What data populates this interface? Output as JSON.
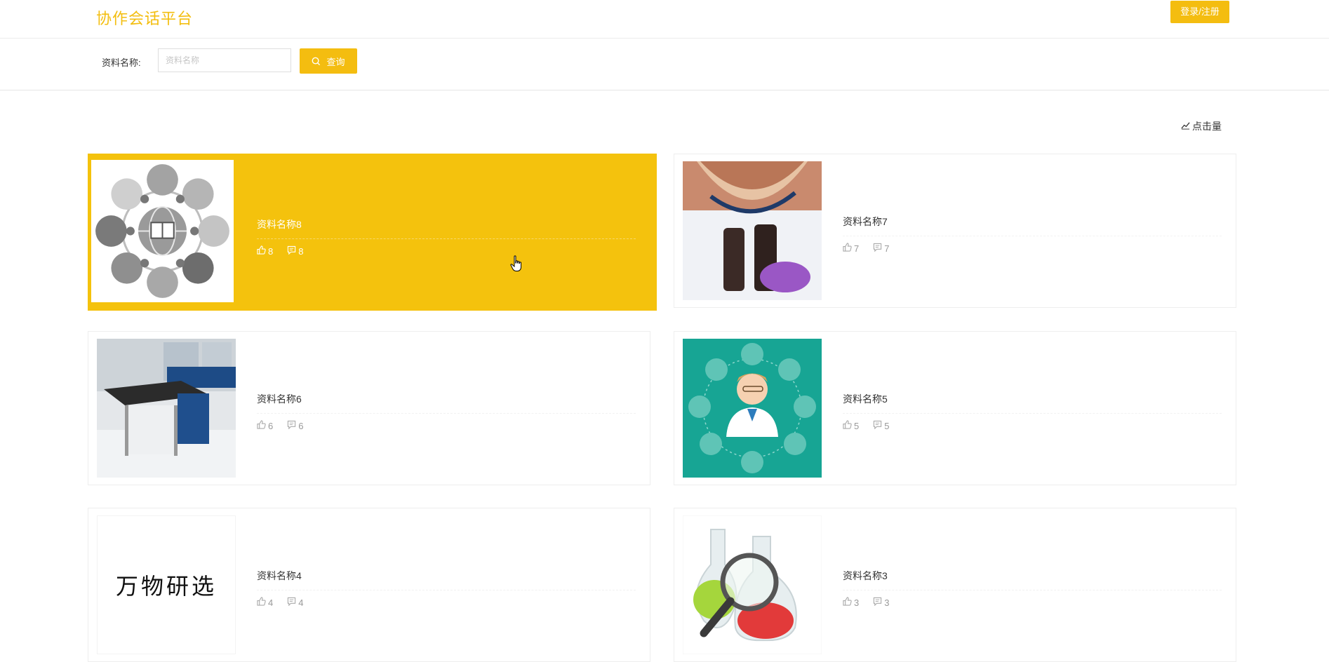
{
  "header": {
    "brand": "协作会话平台",
    "login_label": "登录/注册"
  },
  "search": {
    "label": "资料名称:",
    "placeholder": "资料名称",
    "button_label": "查询"
  },
  "sort": {
    "label": "点击量"
  },
  "colors": {
    "accent": "#f4bd10"
  },
  "cards": [
    {
      "title": "资料名称8",
      "likes": "8",
      "comments": "8",
      "image": "science-icons-circle"
    },
    {
      "title": "资料名称7",
      "likes": "7",
      "comments": "7",
      "image": "microscope-researcher"
    },
    {
      "title": "资料名称6",
      "likes": "6",
      "comments": "6",
      "image": "laboratory-room"
    },
    {
      "title": "资料名称5",
      "likes": "5",
      "comments": "5",
      "image": "doctor-illustration"
    },
    {
      "title": "资料名称4",
      "likes": "4",
      "comments": "4",
      "image_text": "万物研选"
    },
    {
      "title": "资料名称3",
      "likes": "3",
      "comments": "3",
      "image": "flasks-magnifier"
    }
  ]
}
